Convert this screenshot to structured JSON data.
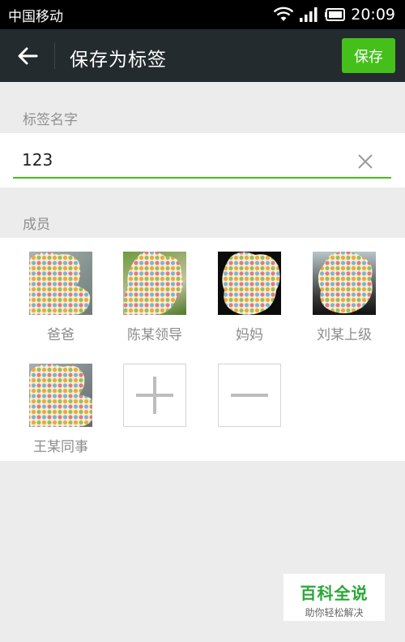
{
  "status_bar": {
    "carrier": "中国移动",
    "time": "20:09"
  },
  "header": {
    "title": "保存为标签",
    "save_label": "保存"
  },
  "tag_name": {
    "section_label": "标签名字",
    "value": "123"
  },
  "members": {
    "section_label": "成员",
    "items": [
      {
        "name": "爸爸",
        "icon": "avatar-photo"
      },
      {
        "name": "陈某领导",
        "icon": "avatar-photo"
      },
      {
        "name": "妈妈",
        "icon": "avatar-photo"
      },
      {
        "name": "刘某上级",
        "icon": "avatar-photo"
      },
      {
        "name": "王某同事",
        "icon": "avatar-photo"
      }
    ],
    "add_icon": "plus-icon",
    "remove_icon": "minus-icon"
  },
  "watermark": {
    "title": "百科全说",
    "subtitle": "助你轻松解决"
  },
  "colors": {
    "accent": "#45c01a",
    "title_bar": "#242b2e",
    "background": "#ececec"
  }
}
